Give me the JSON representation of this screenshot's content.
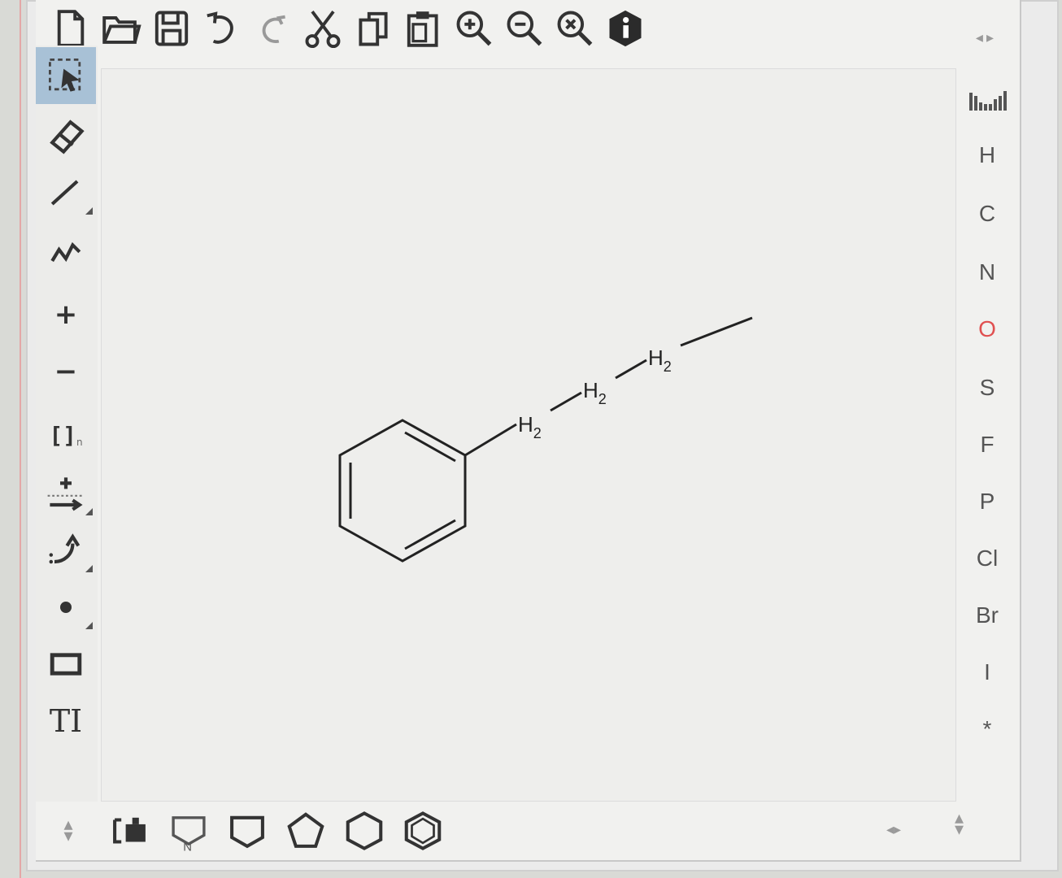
{
  "toolbar": {
    "items": [
      "new-icon",
      "open-icon",
      "save-icon",
      "undo-icon",
      "redo-icon",
      "cut-icon",
      "copy-icon",
      "paste-icon",
      "zoom-in-icon",
      "zoom-out-icon",
      "zoom-reset-icon",
      "info-icon"
    ]
  },
  "left_tools": {
    "items": [
      "select-icon",
      "eraser-icon",
      "single-bond-icon",
      "chain-icon",
      "charge-plus-icon",
      "charge-minus-icon",
      "sgroup-icon",
      "reaction-arrow-icon",
      "rotate-icon",
      "radical-icon",
      "rectangle-icon",
      "text-tool-icon"
    ],
    "charge_plus_label": "+",
    "charge_minus_label": "−",
    "sgroup_label": "[]",
    "sgroup_sub": "n",
    "text_tool_label": "T"
  },
  "structure": {
    "labels": [
      "H2",
      "H2",
      "H2"
    ]
  },
  "elements": {
    "items": [
      "H",
      "C",
      "N",
      "O",
      "S",
      "F",
      "P",
      "Cl",
      "Br",
      "I",
      "*"
    ],
    "colors": {
      "default": "#555555",
      "O": "#e05050"
    }
  },
  "bottom_templates": {
    "items": [
      "template-library-icon",
      "functional-group-icon",
      "cyclopropane-icon",
      "cyclopentane-icon",
      "cyclohexane-icon",
      "benzene-icon"
    ]
  }
}
